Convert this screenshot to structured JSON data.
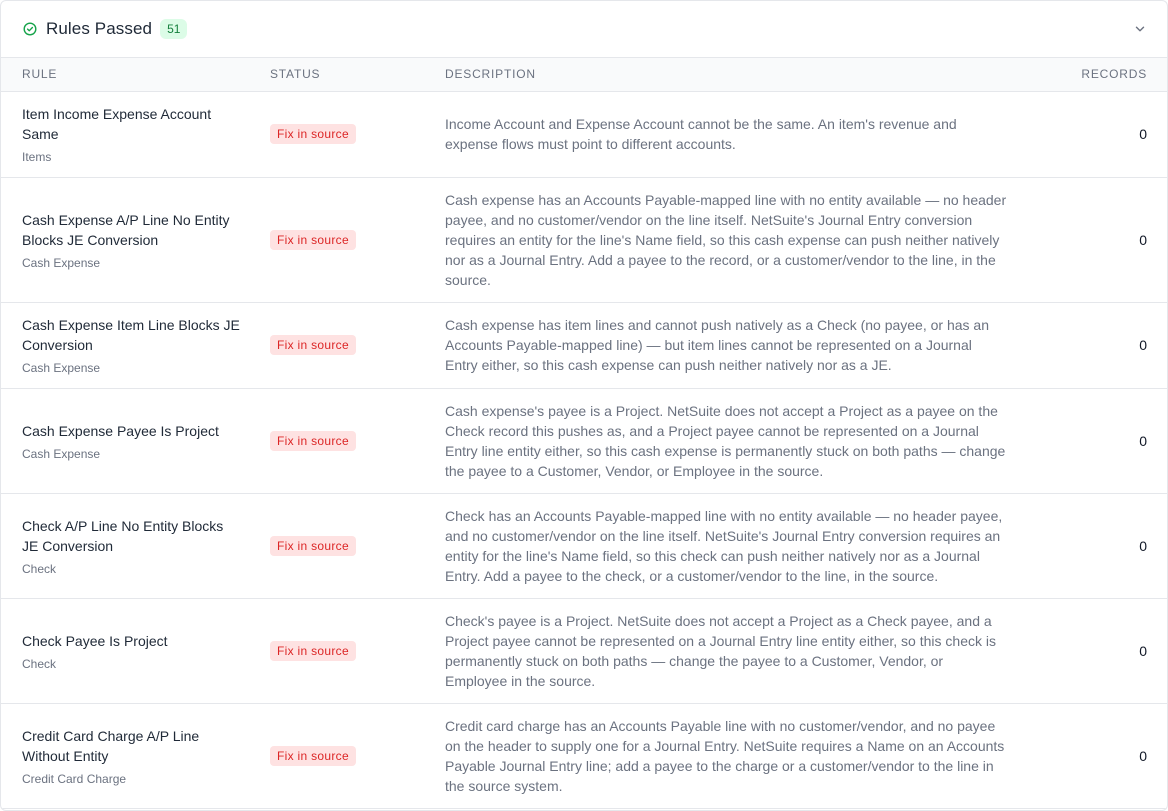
{
  "header": {
    "title": "Rules Passed",
    "count": "51",
    "status_icon": "check-circle-icon",
    "collapse_icon": "chevron-down-icon",
    "accent_color": "#16a34a"
  },
  "table": {
    "columns": {
      "rule": "RULE",
      "status": "STATUS",
      "description": "DESCRIPTION",
      "records": "RECORDS"
    },
    "status_color": "#dc2626",
    "rows": [
      {
        "rule": "Item Income Expense Account Same",
        "category": "Items",
        "status": "Fix in source",
        "description": "Income Account and Expense Account cannot be the same. An item's revenue and expense flows must point to different accounts.",
        "records": "0"
      },
      {
        "rule": "Cash Expense A/P Line No Entity Blocks JE Conversion",
        "category": "Cash Expense",
        "status": "Fix in source",
        "description": "Cash expense has an Accounts Payable-mapped line with no entity available — no header payee, and no customer/vendor on the line itself. NetSuite's Journal Entry conversion requires an entity for the line's Name field, so this cash expense can push neither natively nor as a Journal Entry. Add a payee to the record, or a customer/vendor to the line, in the source.",
        "records": "0"
      },
      {
        "rule": "Cash Expense Item Line Blocks JE Conversion",
        "category": "Cash Expense",
        "status": "Fix in source",
        "description": "Cash expense has item lines and cannot push natively as a Check (no payee, or has an Accounts Payable-mapped line) — but item lines cannot be represented on a Journal Entry either, so this cash expense can push neither natively nor as a JE.",
        "records": "0"
      },
      {
        "rule": "Cash Expense Payee Is Project",
        "category": "Cash Expense",
        "status": "Fix in source",
        "description": "Cash expense's payee is a Project. NetSuite does not accept a Project as a payee on the Check record this pushes as, and a Project payee cannot be represented on a Journal Entry line entity either, so this cash expense is permanently stuck on both paths — change the payee to a Customer, Vendor, or Employee in the source.",
        "records": "0"
      },
      {
        "rule": "Check A/P Line No Entity Blocks JE Conversion",
        "category": "Check",
        "status": "Fix in source",
        "description": "Check has an Accounts Payable-mapped line with no entity available — no header payee, and no customer/vendor on the line itself. NetSuite's Journal Entry conversion requires an entity for the line's Name field, so this check can push neither natively nor as a Journal Entry. Add a payee to the check, or a customer/vendor to the line, in the source.",
        "records": "0"
      },
      {
        "rule": "Check Payee Is Project",
        "category": "Check",
        "status": "Fix in source",
        "description": "Check's payee is a Project. NetSuite does not accept a Project as a Check payee, and a Project payee cannot be represented on a Journal Entry line entity either, so this check is permanently stuck on both paths — change the payee to a Customer, Vendor, or Employee in the source.",
        "records": "0"
      },
      {
        "rule": "Credit Card Charge A/P Line Without Entity",
        "category": "Credit Card Charge",
        "status": "Fix in source",
        "description": "Credit card charge has an Accounts Payable line with no customer/vendor, and no payee on the header to supply one for a Journal Entry. NetSuite requires a Name on an Accounts Payable Journal Entry line; add a payee to the charge or a customer/vendor to the line in the source system.",
        "records": "0"
      }
    ]
  }
}
